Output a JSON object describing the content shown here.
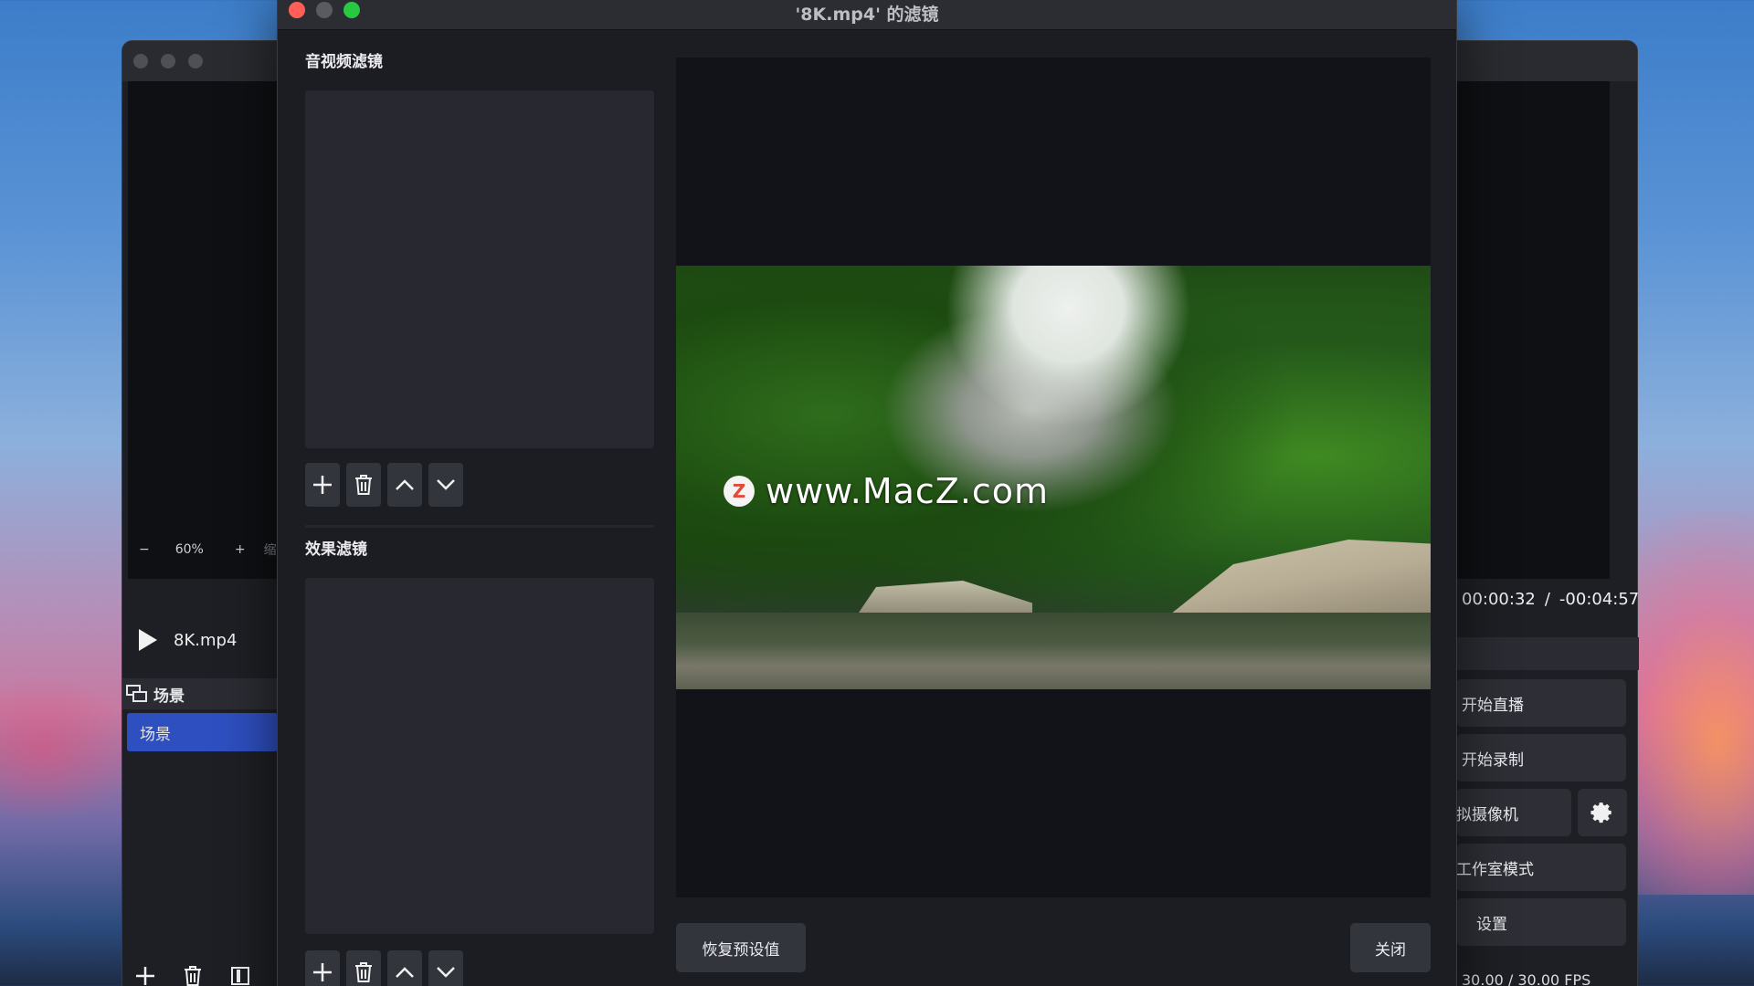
{
  "main_window": {
    "zoom_minus": "−",
    "zoom_level": "60%",
    "zoom_plus": "+",
    "zoom_extra": "缩",
    "media_name": "8K.mp4",
    "time_current": "00:00:32",
    "time_separator": "/",
    "time_remaining": "-00:04:57",
    "scenes_header": "场景",
    "selected_scene": "场景",
    "controls": {
      "start_stream": "开始直播",
      "start_record": "开始录制",
      "virtual_camera": "拟摄像机",
      "studio_mode": "工作室模式",
      "settings": "设置"
    },
    "fps": "30.00 / 30.00 FPS",
    "accent_color": "#2e4fc0"
  },
  "dialog": {
    "title": "'8K.mp4' 的滤镜",
    "av_filters_label": "音视频滤镜",
    "effect_filters_label": "效果滤镜",
    "watermark_text": "www.MacZ.com",
    "watermark_logo_letter": "Z",
    "reset_button": "恢复预设值",
    "close_button": "关闭",
    "traffic_colors": {
      "close": "#ff5f57",
      "minimize": "#5a5b60",
      "zoom": "#28c840"
    }
  }
}
